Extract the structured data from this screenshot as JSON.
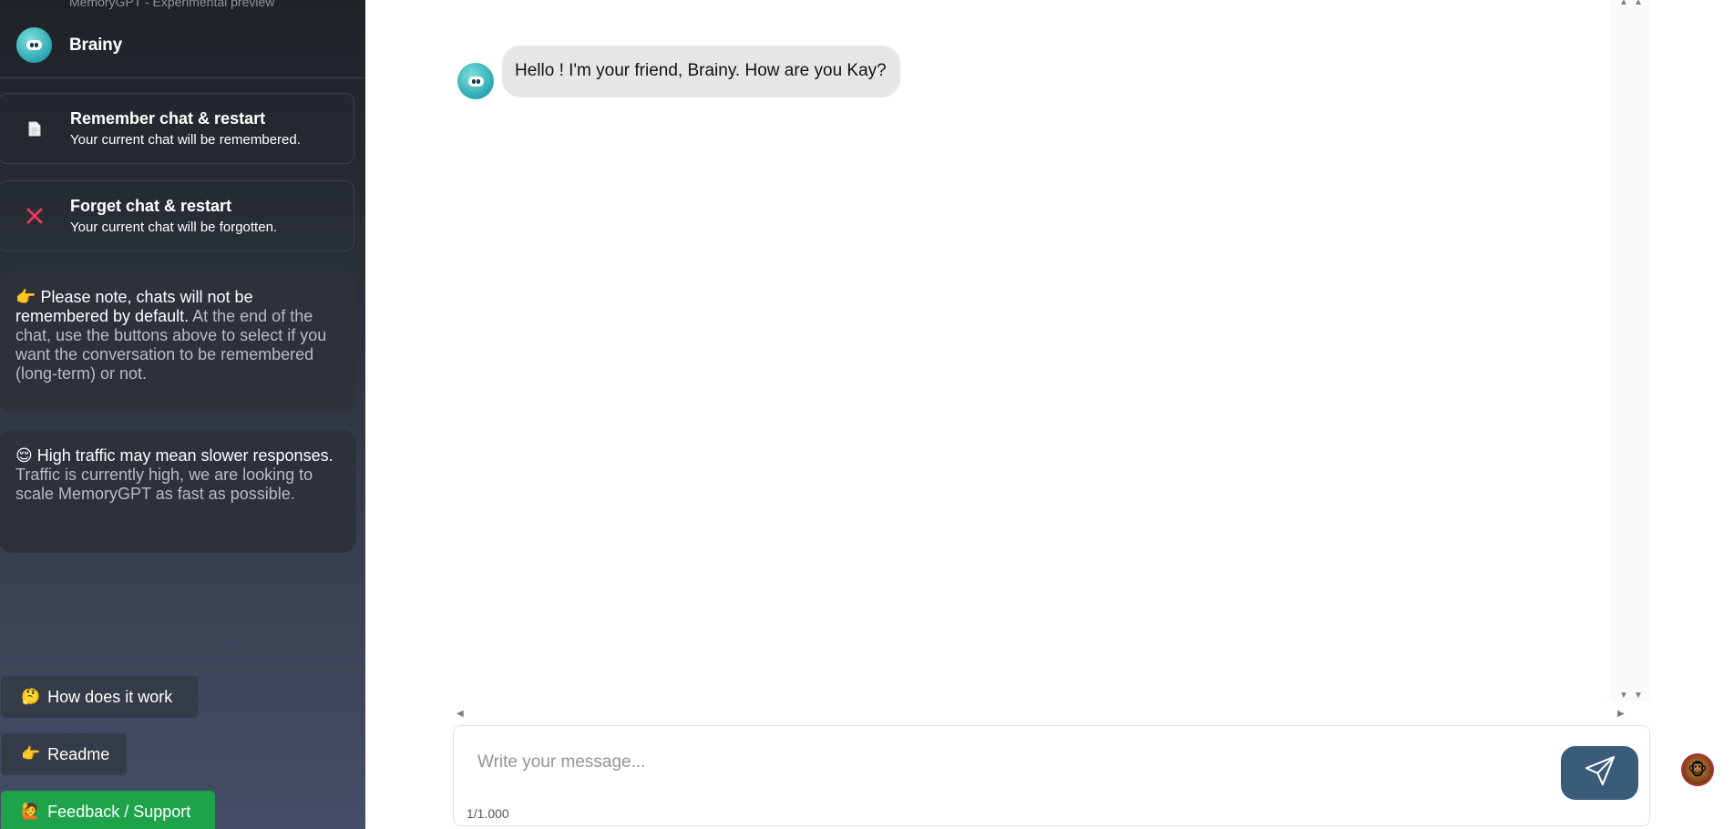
{
  "sidebar": {
    "preview_label": "MemoryGPT - Experimental preview",
    "brand_name": "Brainy",
    "remember": {
      "title": "Remember chat & restart",
      "subtitle": "Your current chat will be remembered.",
      "icon": "document-icon"
    },
    "forget": {
      "title": "Forget chat & restart",
      "subtitle": "Your current chat will be forgotten.",
      "icon": "close-icon"
    },
    "note_default": {
      "emoji": "👉",
      "strong": "Please note, chats will not be remembered by default.",
      "text": " At the end of the chat, use the buttons above to select if you want the conversation to be remembered (long-term) or not."
    },
    "note_traffic": {
      "emoji": "😌",
      "strong": "High traffic may mean slower responses.",
      "text": " Traffic is currently high, we are looking to scale MemoryGPT as fast as possible."
    },
    "buttons": {
      "how": {
        "emoji": "🤔",
        "label": "How does it work"
      },
      "readme": {
        "emoji": "👉",
        "label": "Readme"
      },
      "feedback": {
        "emoji": "🙋",
        "label": "Feedback / Support"
      }
    }
  },
  "chat": {
    "messages": [
      {
        "sender": "Brainy",
        "text": "Hello ! I'm your friend, Brainy. How are you Kay?"
      }
    ]
  },
  "composer": {
    "placeholder": "Write your message...",
    "counter": "1/1.000"
  },
  "colors": {
    "feedback_green": "#1ea34a",
    "send_button": "#3b5c79",
    "forget_icon": "#e8365d"
  }
}
